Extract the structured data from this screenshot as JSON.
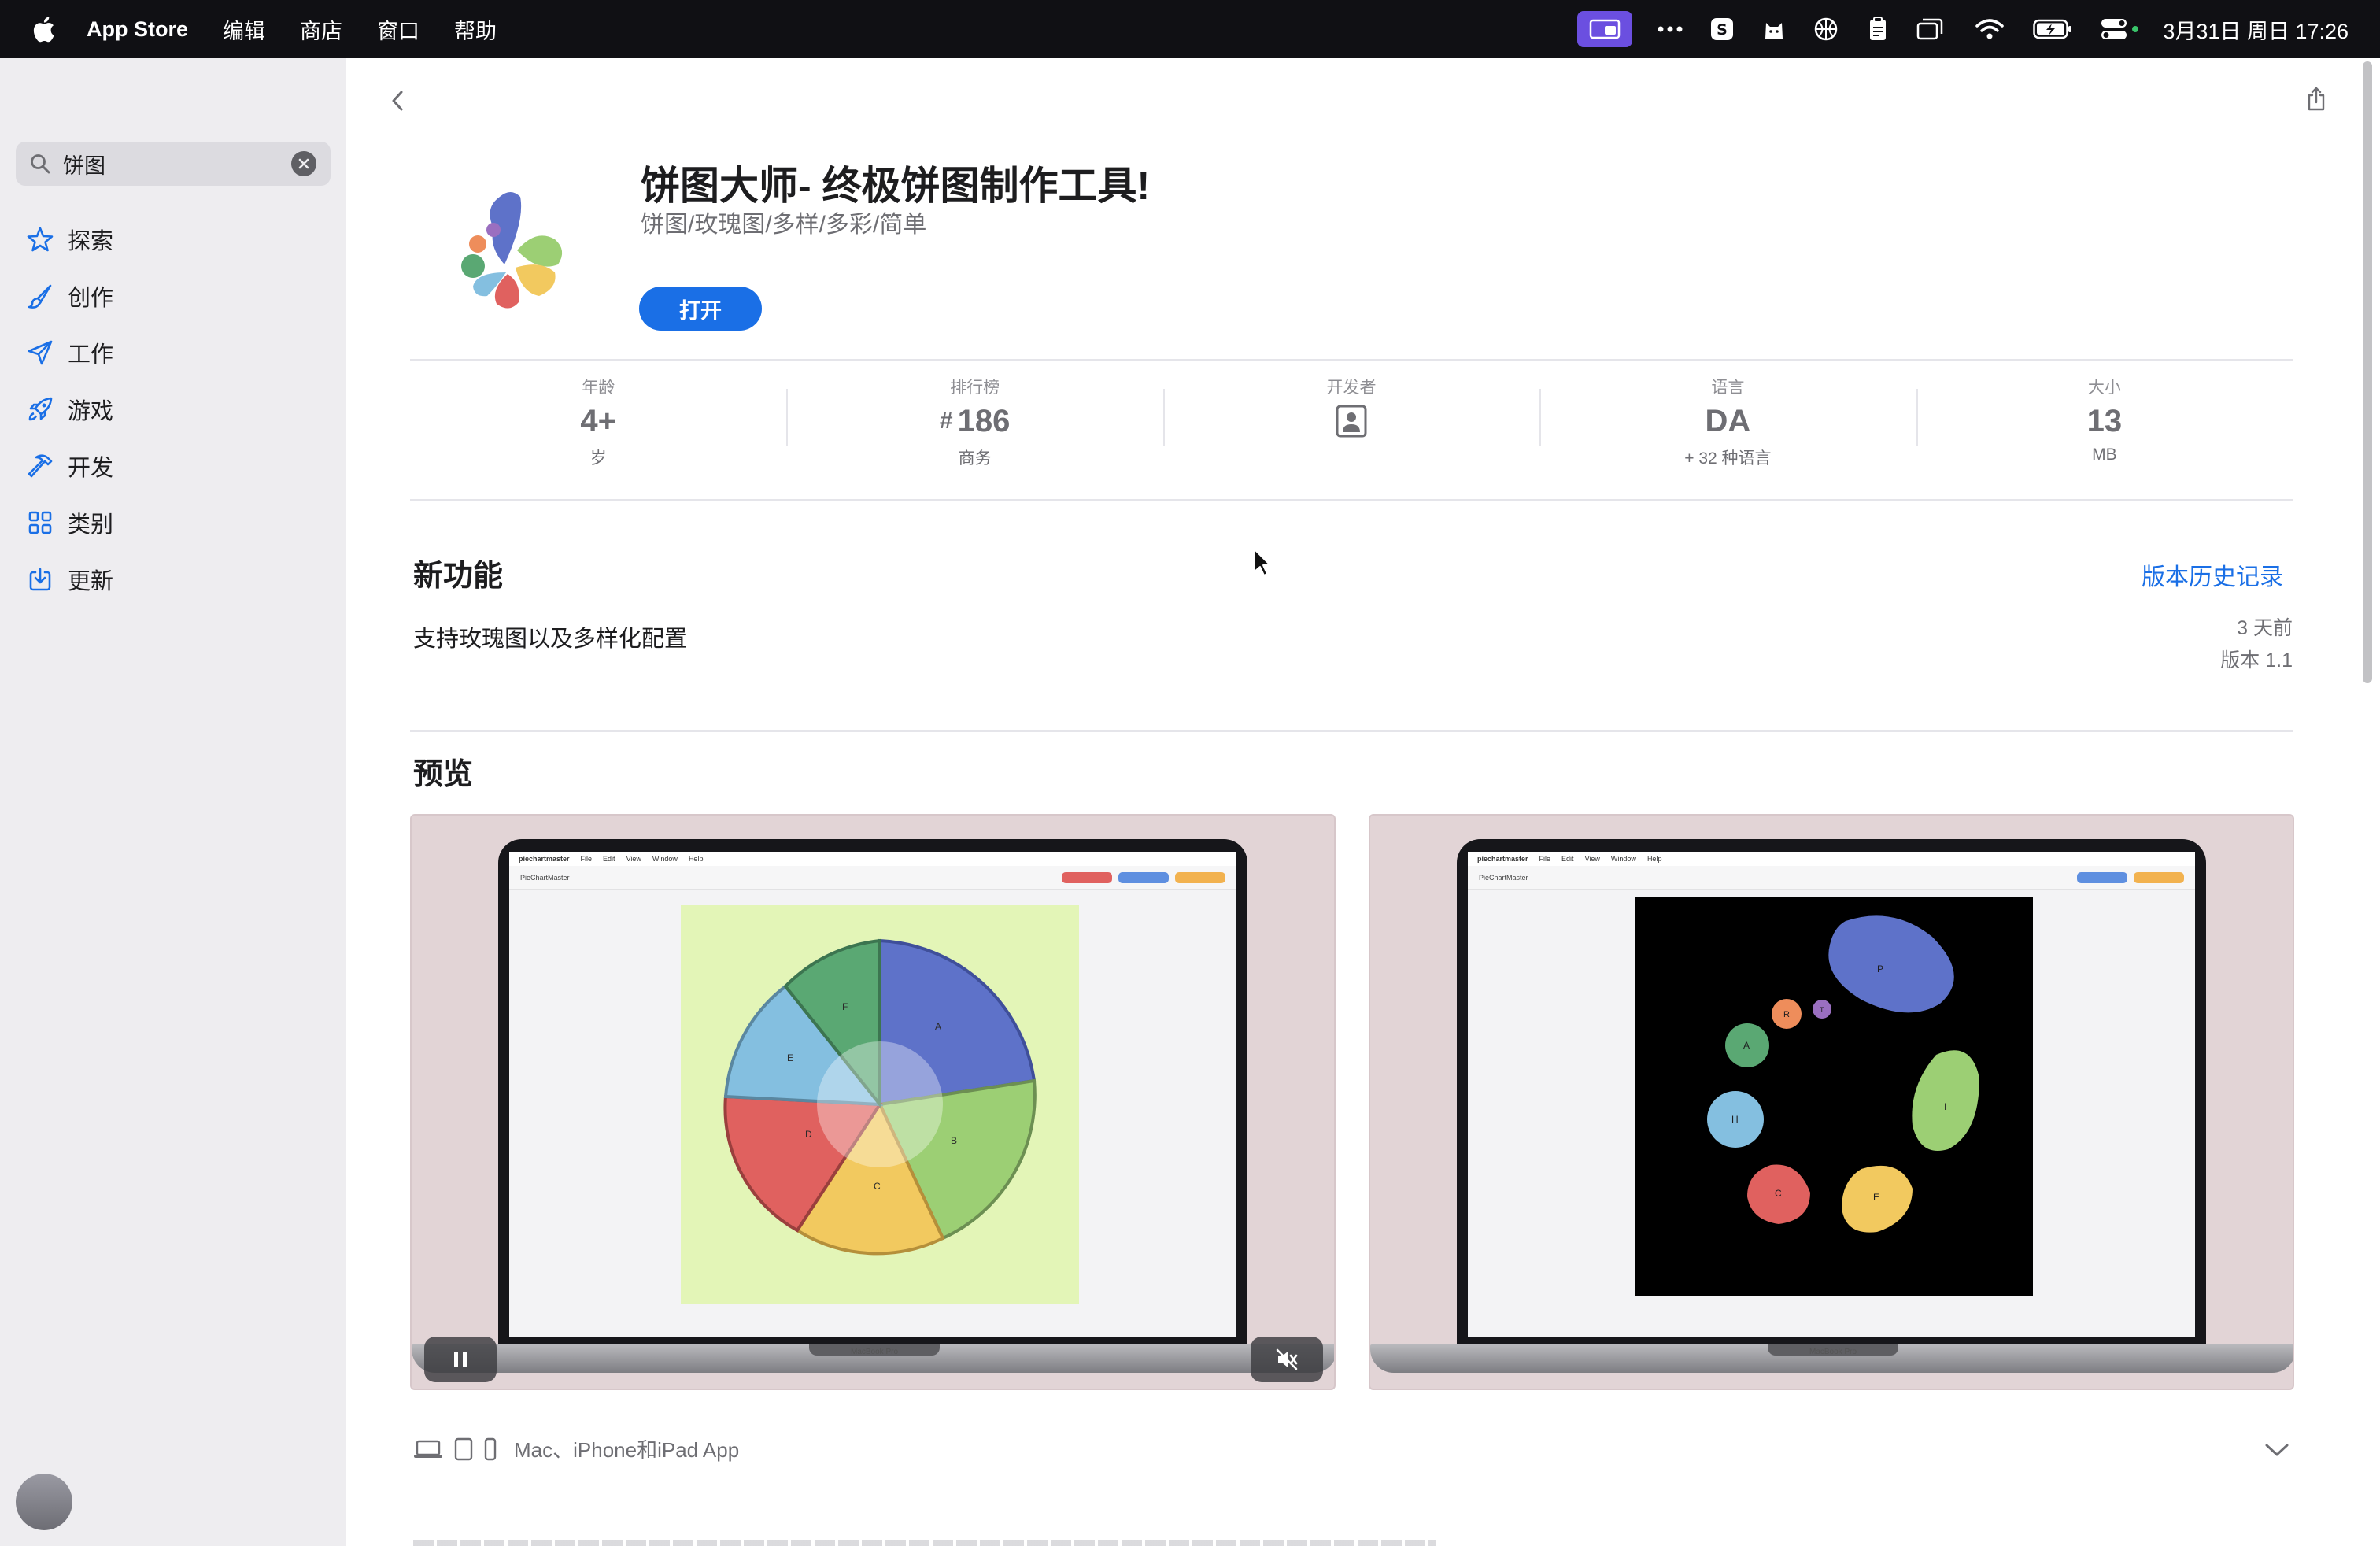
{
  "menubar": {
    "app_name": "App Store",
    "menus": [
      "编辑",
      "商店",
      "窗口",
      "帮助"
    ],
    "clock": "3月31日 周日 17:26",
    "tray_icons": [
      "screen-share-icon",
      "more-icon",
      "s-app-icon",
      "cat-icon",
      "basketball-icon",
      "clipboard-icon",
      "window-icon",
      "wifi-icon",
      "battery-icon",
      "control-center-icon"
    ]
  },
  "sidebar": {
    "search": {
      "value": "饼图"
    },
    "items": [
      {
        "label": "探索",
        "icon": "star-icon"
      },
      {
        "label": "创作",
        "icon": "brush-icon"
      },
      {
        "label": "工作",
        "icon": "paper-plane-icon"
      },
      {
        "label": "游戏",
        "icon": "rocket-icon"
      },
      {
        "label": "开发",
        "icon": "hammer-icon"
      },
      {
        "label": "类别",
        "icon": "grid-icon"
      },
      {
        "label": "更新",
        "icon": "download-icon"
      }
    ]
  },
  "app": {
    "title": "饼图大师- 终极饼图制作工具!",
    "subtitle": "饼图/玫瑰图/多样/多彩/简单",
    "open_label": "打开"
  },
  "stats": [
    {
      "label": "年龄",
      "value": "4+",
      "sub": "岁"
    },
    {
      "label": "排行榜",
      "hash": "#",
      "value": "186",
      "sub": "商务"
    },
    {
      "label": "开发者",
      "icon": "developer-icon"
    },
    {
      "label": "语言",
      "value": "DA",
      "sub": "+ 32 种语言"
    },
    {
      "label": "大小",
      "value": "13",
      "sub": "MB"
    }
  ],
  "whats_new": {
    "title": "新功能",
    "history_link": "版本历史记录",
    "text": "支持玫瑰图以及多样化配置",
    "ago": "3 天前",
    "version": "版本 1.1"
  },
  "preview": {
    "title": "预览",
    "device_caption": "MacBook Pro",
    "mini_app_name": "PieChartMaster",
    "mini_menus": [
      "piechartmaster",
      "File",
      "Edit",
      "View",
      "Window",
      "Help"
    ],
    "rose_labels": [
      "A",
      "B",
      "C",
      "D",
      "E",
      "F"
    ],
    "blob_labels": [
      "P",
      "I",
      "E",
      "C",
      "H",
      "A",
      "R",
      "T"
    ]
  },
  "compat": {
    "label": "Mac、iPhone和iPad App"
  },
  "colors": {
    "accent": "#1a6fe6",
    "blue": "#5e72c9",
    "green": "#9ccf74",
    "yellow": "#f2c95f",
    "red": "#e0615f",
    "lightblue": "#84bfe0",
    "teal": "#5aa873",
    "orange": "#ee8d5b",
    "purple": "#9a6fc0"
  }
}
